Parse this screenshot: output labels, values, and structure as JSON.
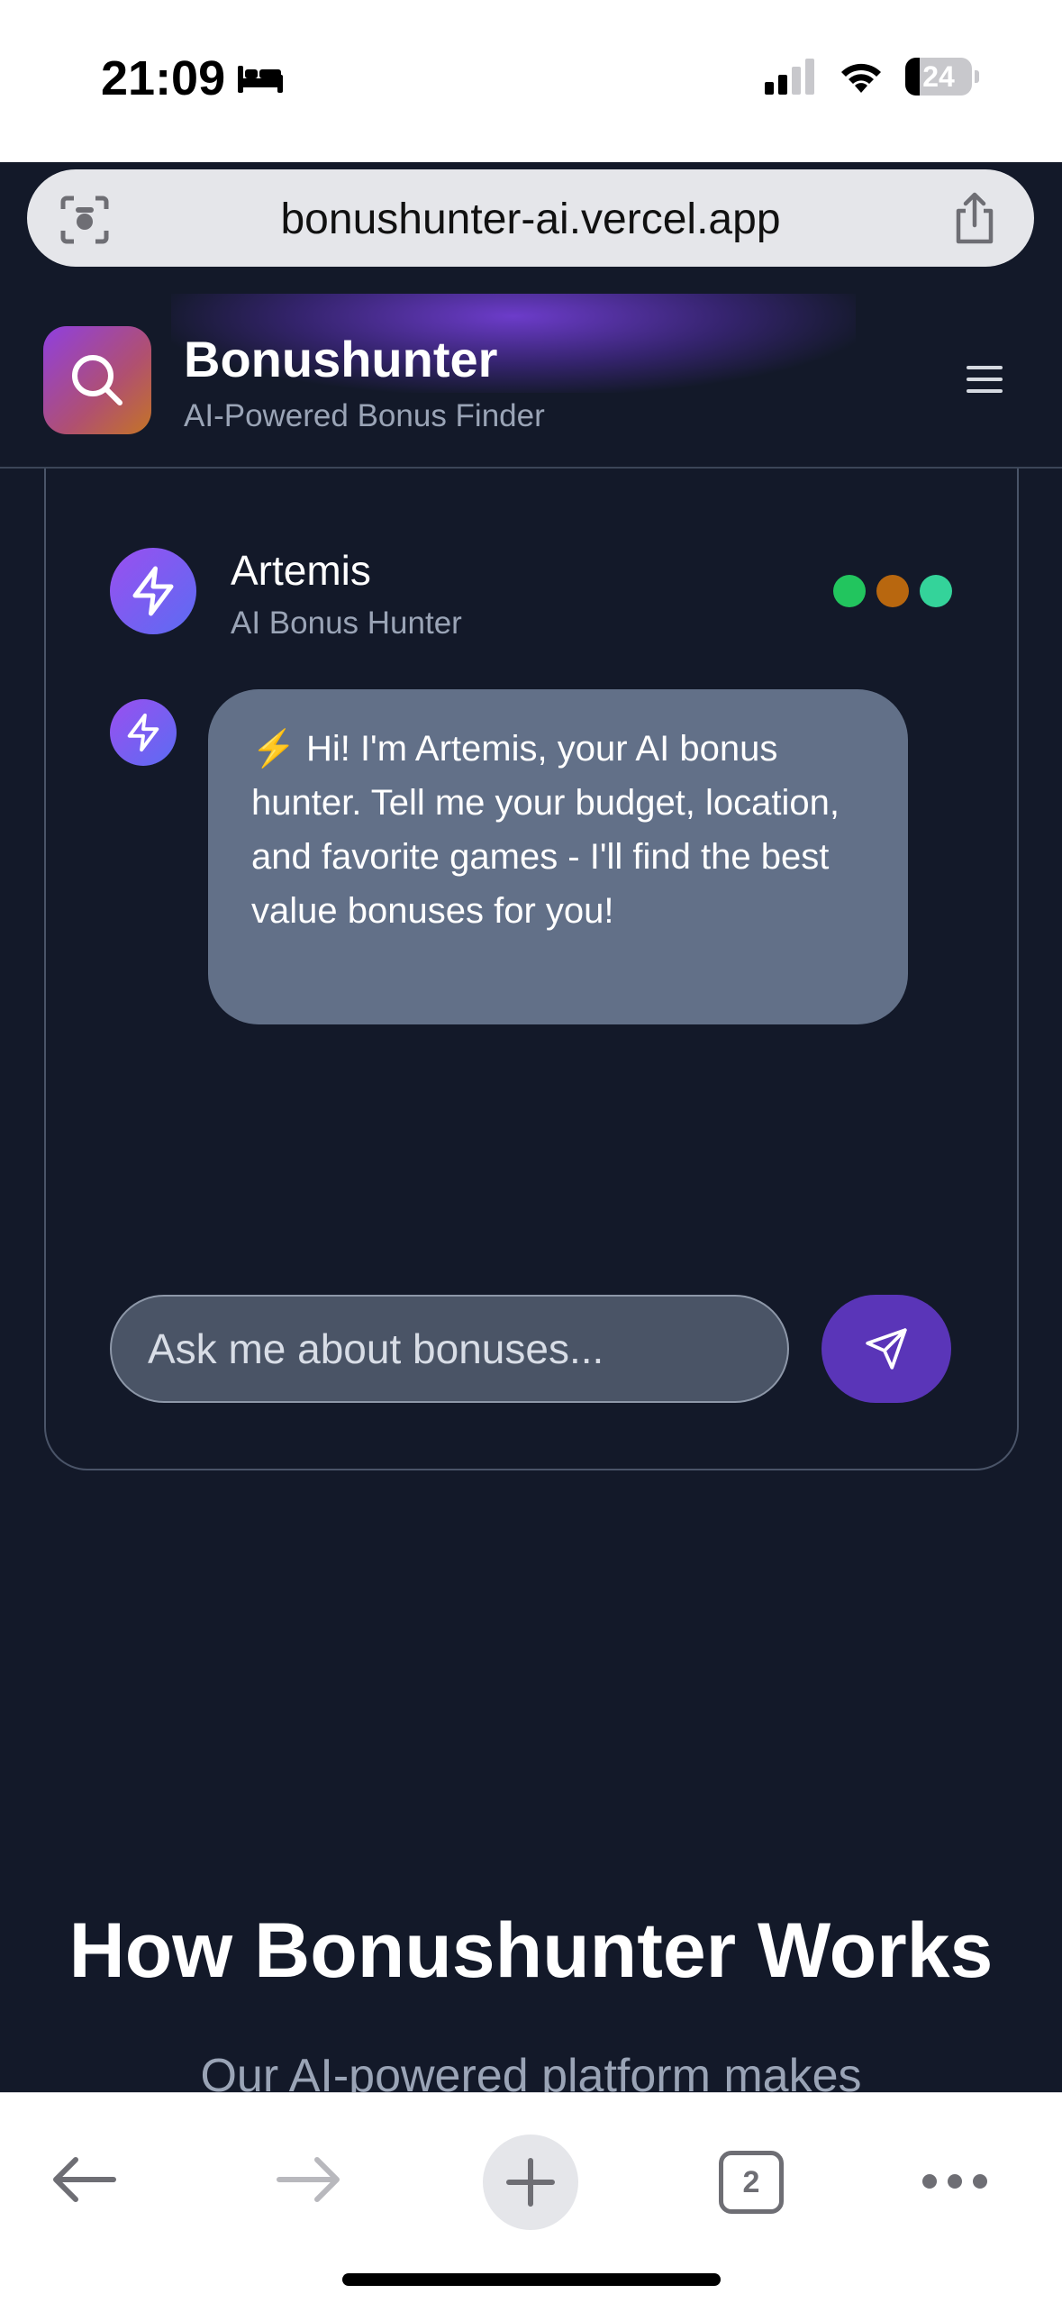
{
  "status_bar": {
    "time": "21:09",
    "battery": "24",
    "icons": [
      "bed-icon",
      "signal-icon",
      "wifi-icon",
      "battery-icon"
    ]
  },
  "browser": {
    "url": "bonushunter-ai.vercel.app",
    "icons": [
      "screen-capture-icon",
      "share-icon"
    ]
  },
  "header": {
    "title": "Bonushunter",
    "subtitle": "AI-Powered Bonus Finder",
    "icons": [
      "search-icon",
      "menu-icon"
    ]
  },
  "chat": {
    "agent_name": "Artemis",
    "agent_role": "AI Bonus Hunter",
    "status_dot_colors": [
      "#22c55e",
      "#b8670f",
      "#34d39a"
    ],
    "message_emoji": "⚡",
    "message_text": "Hi! I'm Artemis, your AI bonus hunter. Tell me your budget, location, and favorite games - I'll find the best value bonuses for you!",
    "input_placeholder": "Ask me about bonuses...",
    "icons": [
      "lightning-icon",
      "send-icon"
    ]
  },
  "section": {
    "title": "How Bonushunter Works",
    "subtitle": "Our AI-powered platform makes"
  },
  "bottom_bar": {
    "tab_count": "2",
    "icons": [
      "back-arrow-icon",
      "forward-arrow-icon",
      "plus-icon",
      "tabs-icon",
      "more-icon"
    ]
  },
  "colors": {
    "background": "#131929",
    "accent": "#5a35b8",
    "bubble": "#627088"
  }
}
